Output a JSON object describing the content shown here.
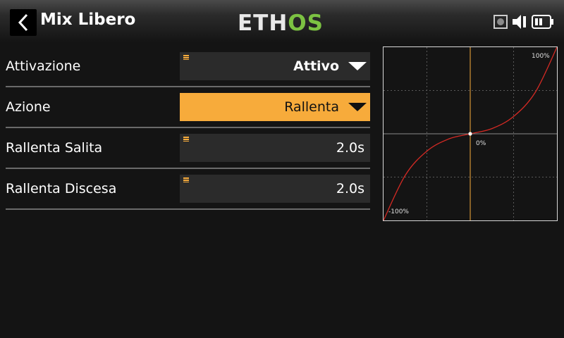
{
  "header": {
    "title": "Mix Libero",
    "logo_part1": "ETH",
    "logo_part2": "OS",
    "back_icon": "chevron-left-icon",
    "status_icons": [
      "record-icon",
      "speaker-icon",
      "battery-icon"
    ]
  },
  "colors": {
    "accent": "#f7ab3b",
    "logo_green": "#7cc242",
    "curve": "#d42a24",
    "field_bg": "#2b2b2b"
  },
  "rows": [
    {
      "label": "Attivazione",
      "value": "Attivo"
    },
    {
      "label": "Azione",
      "value": "Rallenta"
    },
    {
      "label": "Rallenta Salita",
      "value": "2.0s"
    },
    {
      "label": "Rallenta Discesa",
      "value": "2.0s"
    }
  ],
  "graph": {
    "label_max": "100%",
    "label_center": "0%",
    "label_min": "-100%"
  },
  "chart_data": {
    "type": "line",
    "xlim": [
      -100,
      100
    ],
    "ylim": [
      -100,
      100
    ],
    "grid": true,
    "current_x": 0,
    "series": [
      {
        "x": [
          -100,
          -75,
          -50,
          -25,
          0,
          25,
          50,
          75,
          100
        ],
        "values": [
          -100,
          -48,
          -20,
          -6,
          0,
          6,
          20,
          48,
          100
        ]
      }
    ]
  }
}
